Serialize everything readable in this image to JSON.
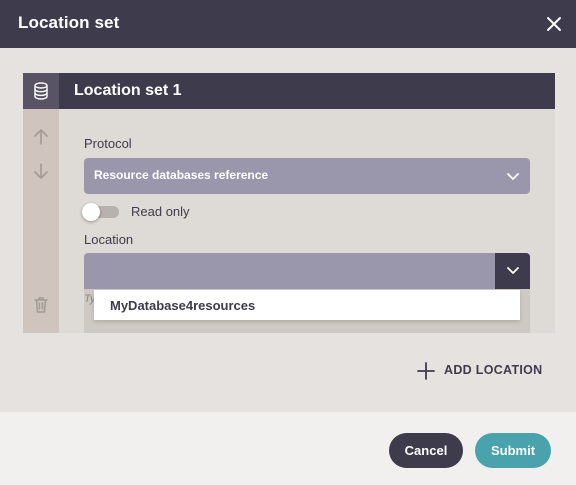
{
  "dialog": {
    "title": "Location set",
    "close_icon": "close-icon"
  },
  "card": {
    "title": "Location set 1",
    "icon": "database-icon",
    "rail_icons": [
      "arrow-up-icon",
      "arrow-down-icon",
      "trash-icon"
    ],
    "protocol": {
      "label": "Protocol",
      "value": "Resource databases reference"
    },
    "read_only": {
      "label": "Read only",
      "checked": false
    },
    "location": {
      "label": "Location",
      "value": "",
      "hint": "Ty",
      "options": [
        "MyDatabase4resources"
      ]
    }
  },
  "actions": {
    "add_location": "ADD LOCATION",
    "cancel": "Cancel",
    "submit": "Submit"
  },
  "colors": {
    "header": "#3e3b4c",
    "select": "#9a97ac",
    "accent": "#4aa3ac"
  }
}
